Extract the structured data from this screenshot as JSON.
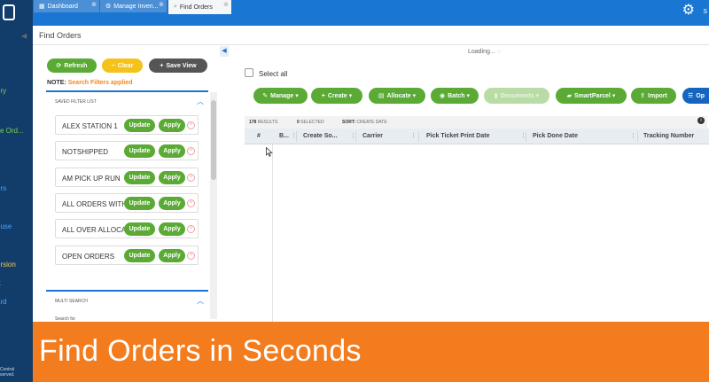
{
  "nav": {
    "items": [
      "s",
      "ery",
      "s",
      "se Ord...",
      "s",
      "ers",
      "ouse",
      "ersion",
      "rt",
      "ard"
    ],
    "footer": [
      "Central",
      "served."
    ]
  },
  "tabs": [
    {
      "label": "Dashboard",
      "icon": "dashboard-icon"
    },
    {
      "label": "Manage Inven...",
      "icon": "gears-icon"
    },
    {
      "label": "Find Orders",
      "icon": "search-icon"
    }
  ],
  "header": {
    "user_initial": "S",
    "page_title": "Find Orders"
  },
  "filters": {
    "refresh_label": "Refresh",
    "clear_label": "Clear",
    "save_view_label": "Save View",
    "note_label": "NOTE:",
    "note_text": "Search Filters applied",
    "saved_list_title": "SAVED FILTER LIST",
    "saved": [
      "ALEX STATION 1",
      "NOTSHIPPED",
      "AM PICK UP RUN",
      "ALL ORDERS WITH...",
      "ALL OVER ALLOCA...",
      "OPEN ORDERS"
    ],
    "update_label": "Update",
    "apply_label": "Apply",
    "multi_search_title": "MULTI SEARCH",
    "search_for_label": "Search for"
  },
  "main": {
    "loading": "Loading...",
    "select_all": "Select all",
    "actions": [
      "Manage",
      "Create",
      "Allocate",
      "Batch",
      "Documents",
      "SmartParcel",
      "Import",
      "Op"
    ],
    "results_count": "178",
    "results_label": "RESULTS",
    "selected_count": "0",
    "selected_label": "SELECTED",
    "sort_label": "SORT:",
    "sort_value": "CREATE DATE",
    "columns": [
      "#",
      "B...",
      "Create So...",
      "Carrier",
      "Pick Ticket Print Date",
      "Pick Done Date",
      "Tracking Number"
    ]
  },
  "banner": {
    "text": "Find Orders in Seconds"
  },
  "colors": {
    "topbar": "#1976d2",
    "nav": "#123d6a",
    "green": "#5aaa35",
    "orange": "#f27c1e",
    "yellow": "#f5c21a"
  }
}
